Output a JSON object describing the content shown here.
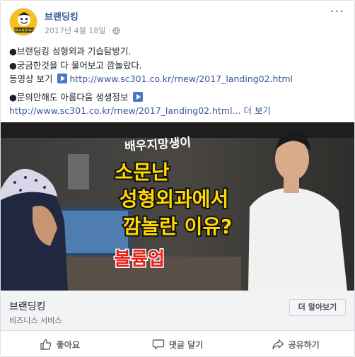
{
  "header": {
    "page_name": "브랜딩킹",
    "date": "2017년 4월 18일 · ",
    "avatar_text": "BRANDING",
    "more_label": "···"
  },
  "post": {
    "line1": "●브랜딩킹 성형외과 기습탐방기.",
    "line2": "●궁금한것을 다 물어보고 깜놀랐다.",
    "line3_label": "동영상 보기 ",
    "line3_url": "http://www.sc301.co.kr/rnew/2017_landing02.html",
    "line4": "●문의만해도 아름다움 생생정보 ",
    "line5_url": "http://www.sc301.co.kr/rnew/2017_landing02.html",
    "line5_more": "... 더 보기"
  },
  "media": {
    "caption_top": "배우지망생이",
    "caption_l1": "소문난",
    "caption_l2": "성형외과에서",
    "caption_l3": "깜놀란 이유?",
    "caption_bottom": "볼륨업"
  },
  "link_bar": {
    "title": "브랜딩킹",
    "subtitle": "비즈니스 서비스",
    "button": "더 알아보기"
  },
  "actions": {
    "like": "좋아요",
    "comment": "댓글 달기",
    "share": "공유하기"
  },
  "colors": {
    "link": "#385898",
    "caption_yellow": "#ffd800",
    "caption_red": "#e8201a"
  }
}
